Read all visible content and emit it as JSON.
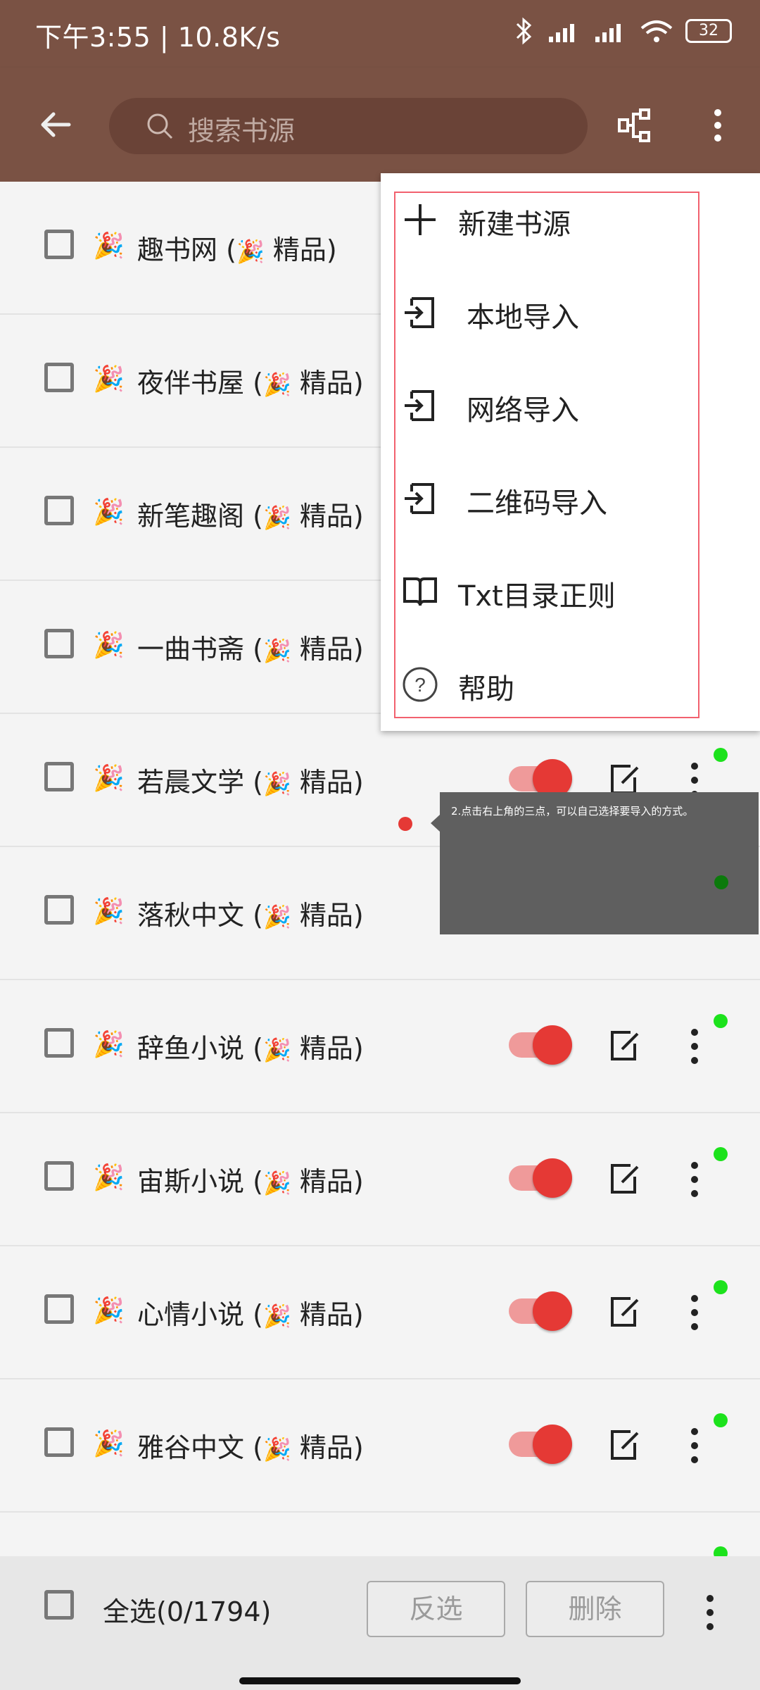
{
  "status_bar": {
    "time_speed": "下午3:55 | 10.8K/s",
    "battery": "32"
  },
  "appbar": {
    "search_placeholder": "搜索书源",
    "icons": [
      "back-arrow-icon",
      "search-icon",
      "group-icon",
      "overflow-menu-icon"
    ]
  },
  "colors": {
    "appbar": "#7a5244",
    "accent_red": "#e53935",
    "toggle_track": "#ef9a9a",
    "green_dot": "#1ce21c",
    "menu_outline": "#f2616e"
  },
  "sources": [
    {
      "name": "趣书网",
      "emoji": "🎉",
      "suffix_open": "(",
      "suffix_label": "精品",
      "suffix_close": ")"
    },
    {
      "name": "夜伴书屋",
      "emoji": "🎉",
      "suffix_open": "(",
      "suffix_label": "精品",
      "suffix_close": ")"
    },
    {
      "name": "新笔趣阁",
      "emoji": "🎉",
      "suffix_open": "(",
      "suffix_label": "精品",
      "suffix_close": ")"
    },
    {
      "name": "一曲书斋",
      "emoji": "🎉",
      "suffix_open": "(",
      "suffix_label": "精品",
      "suffix_close": ")"
    },
    {
      "name": "若晨文学",
      "emoji": "🎉",
      "suffix_open": "(",
      "suffix_label": "精品",
      "suffix_close": ")"
    },
    {
      "name": "落秋中文",
      "emoji": "🎉",
      "suffix_open": "(",
      "suffix_label": "精品",
      "suffix_close": ")"
    },
    {
      "name": "辞鱼小说",
      "emoji": "🎉",
      "suffix_open": "(",
      "suffix_label": "精品",
      "suffix_close": ")"
    },
    {
      "name": "宙斯小说",
      "emoji": "🎉",
      "suffix_open": "(",
      "suffix_label": "精品",
      "suffix_close": ")"
    },
    {
      "name": "心情小说",
      "emoji": "🎉",
      "suffix_open": "(",
      "suffix_label": "精品",
      "suffix_close": ")"
    },
    {
      "name": "雅谷中文",
      "emoji": "🎉",
      "suffix_open": "(",
      "suffix_label": "精品",
      "suffix_close": ")"
    }
  ],
  "menu": {
    "items": [
      {
        "label": "新建书源",
        "icon": "plus-icon"
      },
      {
        "label": "本地导入",
        "icon": "import-icon"
      },
      {
        "label": "网络导入",
        "icon": "import-icon"
      },
      {
        "label": "二维码导入",
        "icon": "import-icon"
      },
      {
        "label": "Txt目录正则",
        "icon": "book-icon"
      },
      {
        "label": "帮助",
        "icon": "help-icon"
      }
    ]
  },
  "tooltip": {
    "text": "2.点击右上角的三点，可以自己选择要导入的方式。"
  },
  "bottom_bar": {
    "select_all": "全选(0/1794)",
    "invert": "反选",
    "delete": "删除"
  }
}
